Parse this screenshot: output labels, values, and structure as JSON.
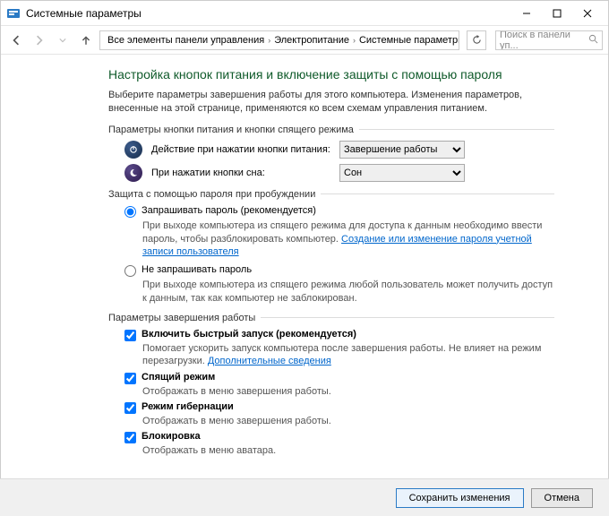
{
  "window": {
    "title": "Системные параметры"
  },
  "breadcrumb": {
    "item1": "Все элементы панели управления",
    "item2": "Электропитание",
    "item3": "Системные параметры"
  },
  "search": {
    "placeholder": "Поиск в панели уп..."
  },
  "page": {
    "heading": "Настройка кнопок питания и включение защиты с помощью пароля",
    "intro": "Выберите параметры завершения работы для этого компьютера. Изменения параметров, внесенные на этой странице, применяются ко всем схемам управления питанием."
  },
  "section_buttons": {
    "title": "Параметры кнопки питания и кнопки спящего режима",
    "power_label": "Действие при нажатии кнопки питания:",
    "power_value": "Завершение работы",
    "sleep_label": "При нажатии кнопки сна:",
    "sleep_value": "Сон"
  },
  "section_password": {
    "title": "Защита с помощью пароля при пробуждении",
    "opt1_label": "Запрашивать пароль (рекомендуется)",
    "opt1_desc_a": "При выходе компьютера из спящего режима для доступа к данным необходимо ввести пароль, чтобы разблокировать компьютер. ",
    "opt1_link": "Создание или изменение пароля учетной записи пользователя",
    "opt2_label": "Не запрашивать пароль",
    "opt2_desc": "При выходе компьютера из спящего режима любой пользователь может получить доступ к данным, так как компьютер не заблокирован."
  },
  "section_shutdown": {
    "title": "Параметры завершения работы",
    "fast_label": "Включить быстрый запуск (рекомендуется)",
    "fast_desc_a": "Помогает ускорить запуск компьютера после завершения работы. Не влияет на режим перезагрузки. ",
    "fast_link": "Дополнительные сведения",
    "sleep_label": "Спящий режим",
    "sleep_desc": "Отображать в меню завершения работы.",
    "hib_label": "Режим гибернации",
    "hib_desc": "Отображать в меню завершения работы.",
    "lock_label": "Блокировка",
    "lock_desc": "Отображать в меню аватара."
  },
  "footer": {
    "save": "Сохранить изменения",
    "cancel": "Отмена"
  }
}
